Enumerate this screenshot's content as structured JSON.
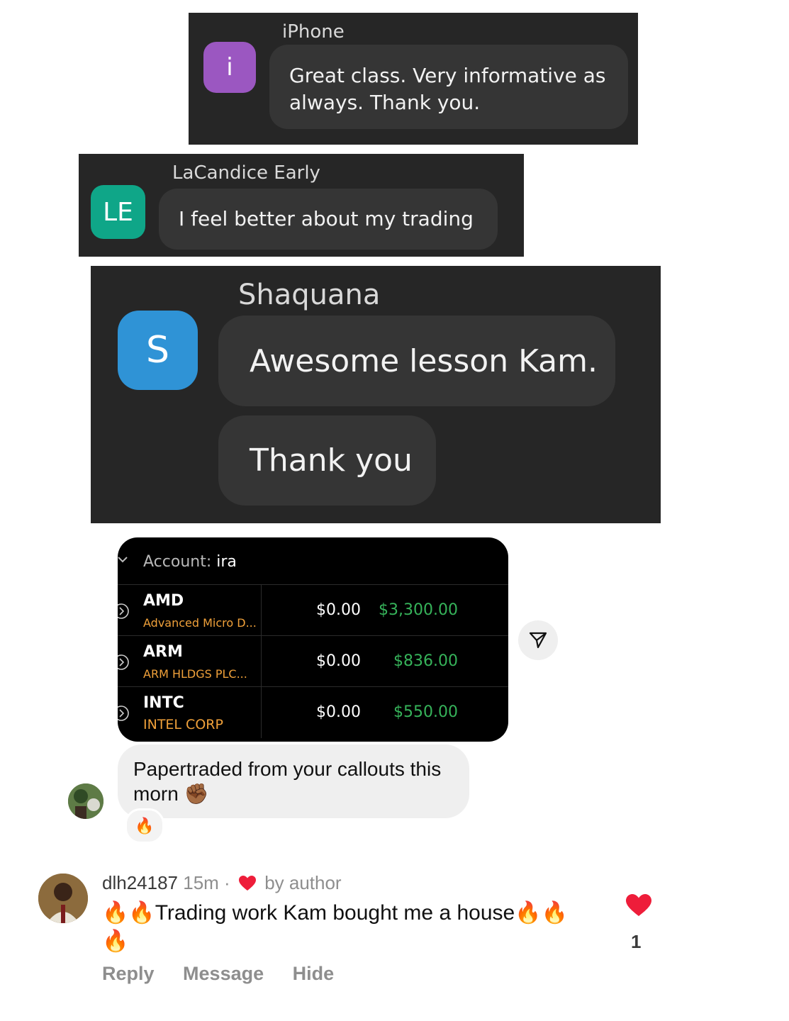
{
  "panel1": {
    "avatar_letter": "i",
    "sender": "iPhone",
    "message": "Great class. Very informative as always. Thank you.",
    "avatar_color": "#9b57c1"
  },
  "panel2": {
    "avatar_letter": "LE",
    "sender": "LaCandice Early",
    "message": "I feel better about my trading",
    "avatar_color": "#0fa688"
  },
  "panel3": {
    "avatar_letter": "S",
    "sender": "Shaquana",
    "messages": [
      "Awesome lesson Kam.",
      "Thank you"
    ],
    "avatar_color": "#2f93d6"
  },
  "holdings": {
    "account_label": "Account:",
    "account_value": "ira",
    "rows": [
      {
        "ticker": "AMD",
        "company": "Advanced Micro D...",
        "cost": "$0.00",
        "value": "$3,300.00"
      },
      {
        "ticker": "ARM",
        "company": "ARM HLDGS PLC...",
        "cost": "$0.00",
        "value": "$836.00"
      },
      {
        "ticker": "INTC",
        "company": "INTEL CORP",
        "cost": "$0.00",
        "value": "$550.00"
      }
    ],
    "value_color": "#36b35a",
    "company_color": "#f0a13a"
  },
  "dm": {
    "message": "Papertraded from your callouts this morn ✊🏾",
    "reaction": "🔥"
  },
  "comment": {
    "username": "dlh24187",
    "time": "15m",
    "separator": "·",
    "by_author": "by author",
    "text": "🔥🔥Trading work Kam bought me a house🔥🔥🔥",
    "actions": [
      "Reply",
      "Message",
      "Hide"
    ],
    "like_count": "1",
    "like_color": "#ee1d3a"
  }
}
